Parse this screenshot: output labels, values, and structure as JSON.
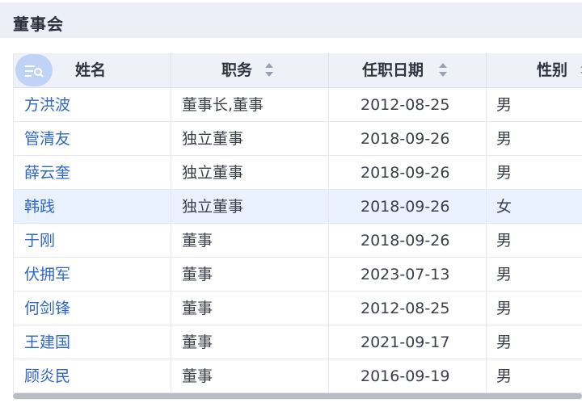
{
  "section": {
    "title": "董事会"
  },
  "table": {
    "columns": [
      {
        "label": "姓名",
        "sortable": false
      },
      {
        "label": "职务",
        "sortable": true
      },
      {
        "label": "任职日期",
        "sortable": true
      },
      {
        "label": "性别",
        "sortable": true
      }
    ],
    "rows": [
      {
        "name": "方洪波",
        "title": "董事长,董事",
        "date": "2012-08-25",
        "gender": "男"
      },
      {
        "name": "管清友",
        "title": "独立董事",
        "date": "2018-09-26",
        "gender": "男"
      },
      {
        "name": "薛云奎",
        "title": "独立董事",
        "date": "2018-09-26",
        "gender": "男"
      },
      {
        "name": "韩践",
        "title": "独立董事",
        "date": "2018-09-26",
        "gender": "女",
        "highlighted": true
      },
      {
        "name": "于刚",
        "title": "董事",
        "date": "2018-09-26",
        "gender": "男"
      },
      {
        "name": "伏拥军",
        "title": "董事",
        "date": "2023-07-13",
        "gender": "男"
      },
      {
        "name": "何剑锋",
        "title": "董事",
        "date": "2012-08-25",
        "gender": "男"
      },
      {
        "name": "王建国",
        "title": "董事",
        "date": "2021-09-17",
        "gender": "男"
      },
      {
        "name": "顾炎民",
        "title": "董事",
        "date": "2016-09-19",
        "gender": "男"
      }
    ]
  },
  "icons": {
    "filter": "filter-list-icon",
    "sort": "sort-icon"
  },
  "colors": {
    "link": "#2f67c7",
    "highlight_row": "#eaf2ff",
    "header_bg": "#eef1f7"
  }
}
